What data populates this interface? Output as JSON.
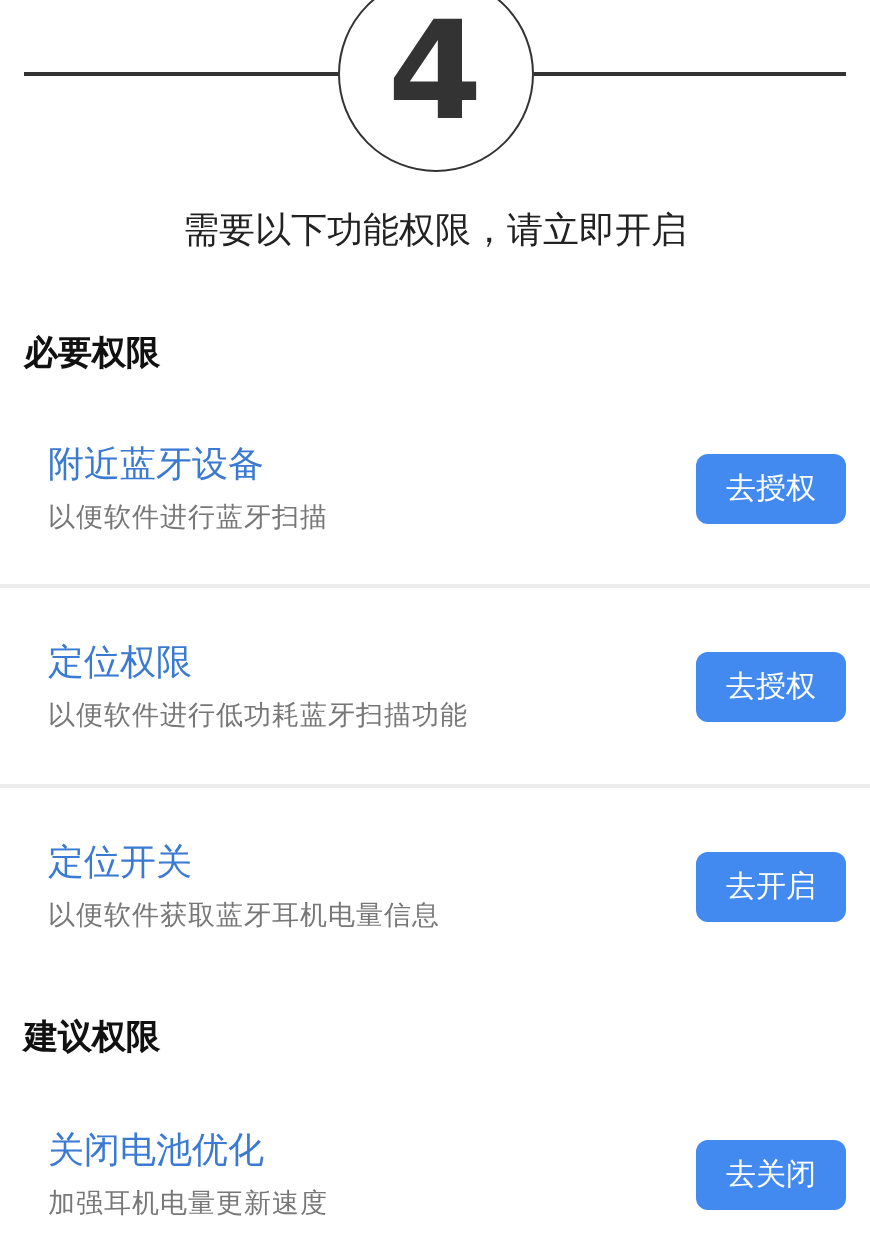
{
  "step": {
    "number": "4"
  },
  "prompt": "需要以下功能权限，请立即开启",
  "sections": [
    {
      "title": "必要权限",
      "items": [
        {
          "title": "附近蓝牙设备",
          "description": "以便软件进行蓝牙扫描",
          "button": "去授权"
        },
        {
          "title": "定位权限",
          "description": "以便软件进行低功耗蓝牙扫描功能",
          "button": "去授权"
        },
        {
          "title": "定位开关",
          "description": "以便软件获取蓝牙耳机电量信息",
          "button": "去开启"
        }
      ]
    },
    {
      "title": "建议权限",
      "items": [
        {
          "title": "关闭电池优化",
          "description": "加强耳机电量更新速度",
          "button": "去关闭"
        }
      ]
    }
  ]
}
